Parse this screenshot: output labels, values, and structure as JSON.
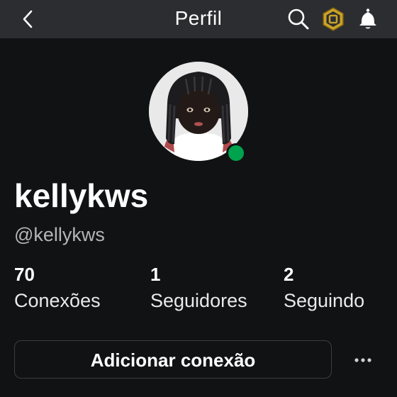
{
  "header": {
    "title": "Perfil",
    "back_icon": "chevron-left-icon",
    "search_icon": "search-icon",
    "robux_icon": "robux-icon",
    "notifications_icon": "bell-icon"
  },
  "profile": {
    "display_name": "kellykws",
    "username": "@kellykws",
    "online_status_color": "#00a34d"
  },
  "stats": [
    {
      "value": "70",
      "label": "Conexões"
    },
    {
      "value": "1",
      "label": "Seguidores"
    },
    {
      "value": "2",
      "label": "Seguindo"
    }
  ],
  "actions": {
    "add_connection_label": "Adicionar conexão",
    "more_icon": "more-horizontal-icon"
  },
  "colors": {
    "background": "#111214",
    "header_background": "#2b2d31",
    "secondary_text": "#b3b5b8",
    "robux_gold": "#c9a227"
  }
}
